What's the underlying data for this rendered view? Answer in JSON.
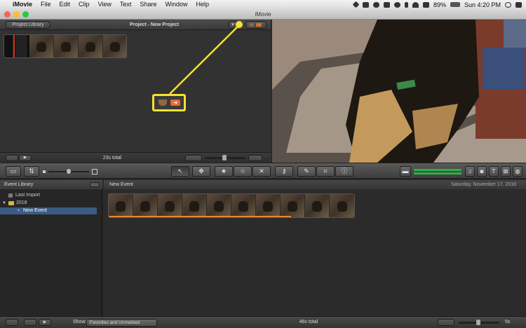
{
  "menubar": {
    "apple": "",
    "app": "iMovie",
    "items": [
      "File",
      "Edit",
      "Clip",
      "View",
      "Text",
      "Share",
      "Window",
      "Help"
    ],
    "battery": "89%",
    "clock": "Sun 4:20 PM"
  },
  "window": {
    "title": "iMovie"
  },
  "project": {
    "library_button": "Project Library",
    "title": "Project - New Project",
    "total": "23s total"
  },
  "event_library": {
    "header": "Event Library",
    "items": [
      {
        "label": "Last Import"
      },
      {
        "label": "2018"
      },
      {
        "label": "New Event"
      }
    ]
  },
  "event_browser": {
    "name": "New Event",
    "date": "Saturday, November 17, 2018"
  },
  "bottom": {
    "show_label": "Show:",
    "show_value": "Favorites and Unmarked",
    "total": "46s total",
    "zoom": "5s"
  },
  "colors": {
    "callout": "#f4e232",
    "audio_meter": "#2fae4a",
    "selected_row": "#3b5b83"
  }
}
